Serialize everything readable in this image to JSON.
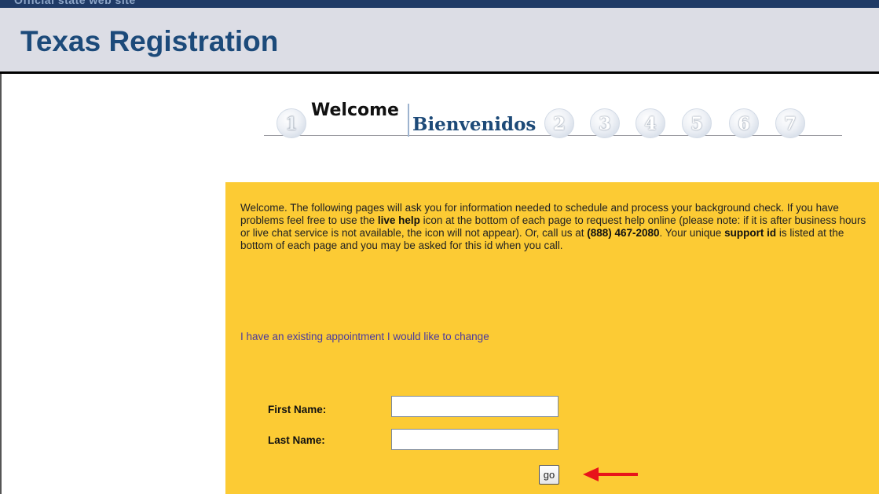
{
  "top_strip": {
    "text": "Official state web site"
  },
  "header": {
    "title": "Texas Registration"
  },
  "steps": {
    "welcome_label": "Welcome",
    "bienvenidos_label": "Bienvenidos",
    "numbers": [
      "1",
      "2",
      "3",
      "4",
      "5",
      "6",
      "7"
    ],
    "active_step": 1
  },
  "intro": {
    "part1": "Welcome. The following pages will ask you for information needed to schedule and process your background check. If you have problems feel free to use the ",
    "live_help": "live help",
    "part2": " icon at the bottom of each page to request help online (please note: if it is after business hours or live chat service is not available, the icon will not appear). Or, call us at ",
    "phone": "(888) 467-2080",
    "part3": ". Your unique ",
    "support_id": "support id",
    "part4": " is listed at the bottom of each page and you may be asked for this id when you call."
  },
  "change_link": "I have an existing appointment I would like to change",
  "form": {
    "first_name_label": "First Name:",
    "first_name_value": "",
    "last_name_label": "Last Name:",
    "last_name_value": "",
    "go_label": "go"
  },
  "colors": {
    "panel": "#fccb34",
    "header_bg": "#dcdde5",
    "title": "#1c4a7a",
    "link": "#4a3aa0",
    "arrow": "#e8141a"
  },
  "icons": {
    "annotation_arrow": "left-arrow-icon"
  }
}
